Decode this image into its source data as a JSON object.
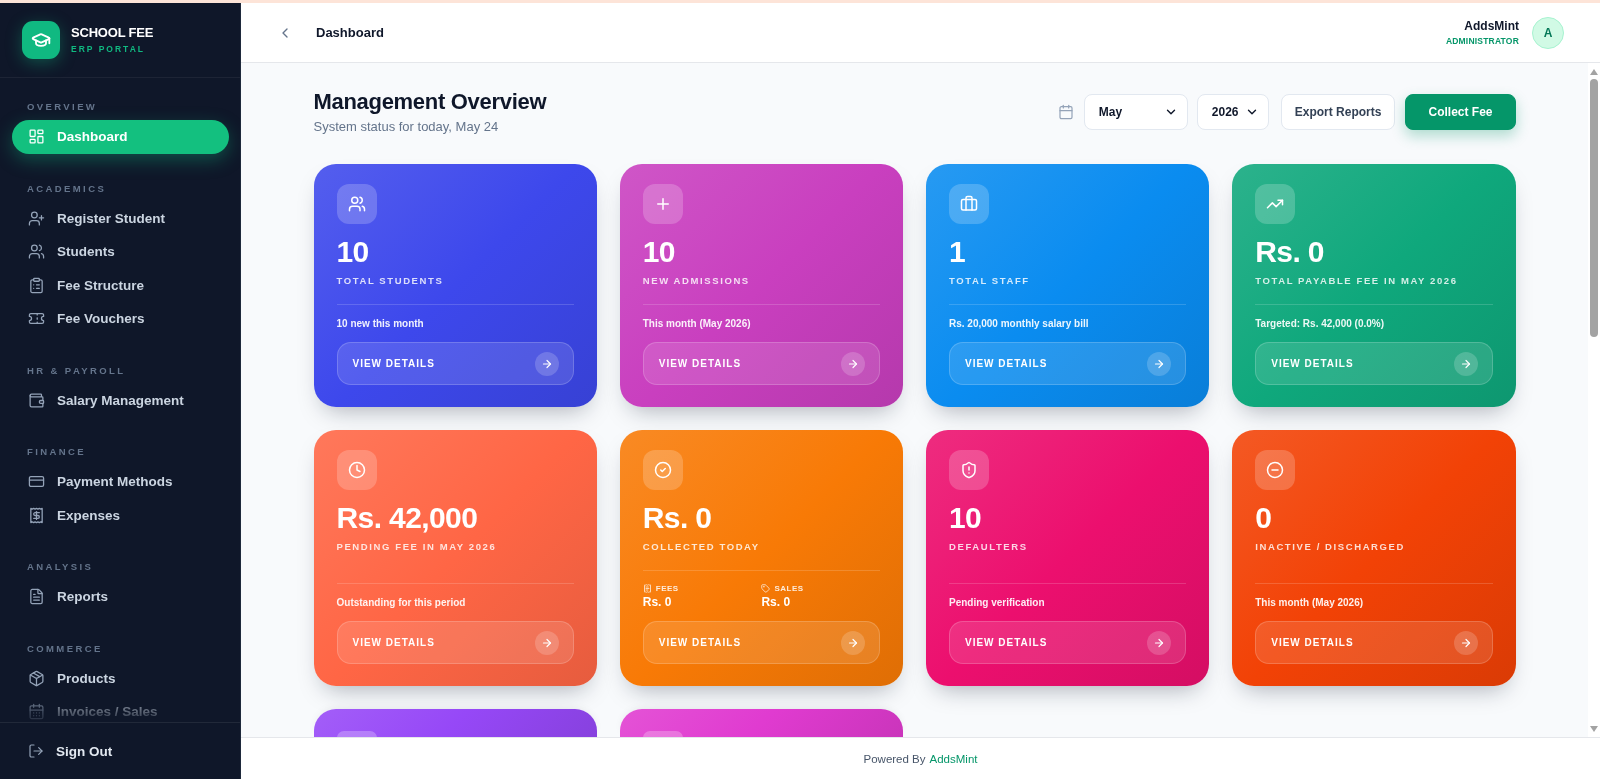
{
  "sidebar": {
    "brand": {
      "title": "SCHOOL FEE",
      "subtitle": "ERP PORTAL"
    },
    "sections": [
      {
        "label": "OVERVIEW",
        "items": [
          {
            "label": "Dashboard",
            "selected": true
          }
        ]
      },
      {
        "label": "ACADEMICS",
        "items": [
          {
            "label": "Register Student",
            "selected": false
          },
          {
            "label": "Students",
            "selected": false
          },
          {
            "label": "Fee Structure",
            "selected": false
          },
          {
            "label": "Fee Vouchers",
            "selected": false
          }
        ]
      },
      {
        "label": "HR & PAYROLL",
        "items": [
          {
            "label": "Salary Management",
            "selected": false
          }
        ]
      },
      {
        "label": "FINANCE",
        "items": [
          {
            "label": "Payment Methods",
            "selected": false
          },
          {
            "label": "Expenses",
            "selected": false
          }
        ]
      },
      {
        "label": "ANALYSIS",
        "items": [
          {
            "label": "Reports",
            "selected": false
          }
        ]
      },
      {
        "label": "COMMERCE",
        "items": [
          {
            "label": "Products",
            "selected": false
          },
          {
            "label": "Invoices / Sales",
            "selected": false
          }
        ]
      }
    ],
    "sign_out": {
      "label": "Sign Out"
    }
  },
  "header": {
    "breadcrumb": "Dashboard",
    "user": {
      "name": "AddsMint",
      "role": "ADMINISTRATOR",
      "initial": "A"
    }
  },
  "page": {
    "title": "Management Overview",
    "subtitle": "System status for today, May 24",
    "filters": {
      "month": "May",
      "year": "2026"
    },
    "actions": [
      {
        "label": "Export Reports",
        "kind": "secondary"
      },
      {
        "label": "Collect Fee",
        "kind": "primary"
      }
    ]
  },
  "cards": [
    {
      "kind": "stat",
      "value": "10",
      "label": "TOTAL STUDENTS",
      "note": "10 new this month",
      "button": "VIEW DETAILS",
      "color": "#3d48ec"
    },
    {
      "kind": "stat",
      "value": "10",
      "label": "NEW ADMISSIONS",
      "note": "This month (May 2026)",
      "button": "VIEW DETAILS",
      "color": "#c93fbf"
    },
    {
      "kind": "stat",
      "value": "1",
      "label": "TOTAL STAFF",
      "note": "Rs. 20,000 monthly salary bill",
      "button": "VIEW DETAILS",
      "color": "#0a8cf0"
    },
    {
      "kind": "stat",
      "value": "Rs. 0",
      "label": "TOTAL PAYABLE FEE IN MAY 2026",
      "note": "Targeted: Rs. 42,000 (0.0%)",
      "button": "VIEW DETAILS",
      "color": "#0fa87c"
    },
    {
      "kind": "stat",
      "value": "Rs. 42,000",
      "label": "PENDING FEE IN MAY 2026",
      "note": "Outstanding for this period",
      "button": "VIEW DETAILS",
      "color": "#ff6645"
    },
    {
      "kind": "split",
      "value": "Rs. 0",
      "label": "COLLECTED TODAY",
      "breakdown": [
        {
          "label": "FEES",
          "value": "Rs. 0"
        },
        {
          "label": "SALES",
          "value": "Rs. 0"
        }
      ],
      "button": "VIEW DETAILS",
      "color": "#f87a06"
    },
    {
      "kind": "stat",
      "value": "10",
      "label": "DEFAULTERS",
      "note": "Pending verification",
      "button": "VIEW DETAILS",
      "color": "#ec0f6e"
    },
    {
      "kind": "stat",
      "value": "0",
      "label": "INACTIVE / DISCHARGED",
      "note": "This month (May 2026)",
      "button": "VIEW DETAILS",
      "color": "#f24206"
    },
    {
      "kind": "peek",
      "color": "#9648f7"
    },
    {
      "kind": "peek",
      "color": "#e03bd0"
    }
  ],
  "footer": {
    "text": "Powered By",
    "link": "AddsMint"
  }
}
